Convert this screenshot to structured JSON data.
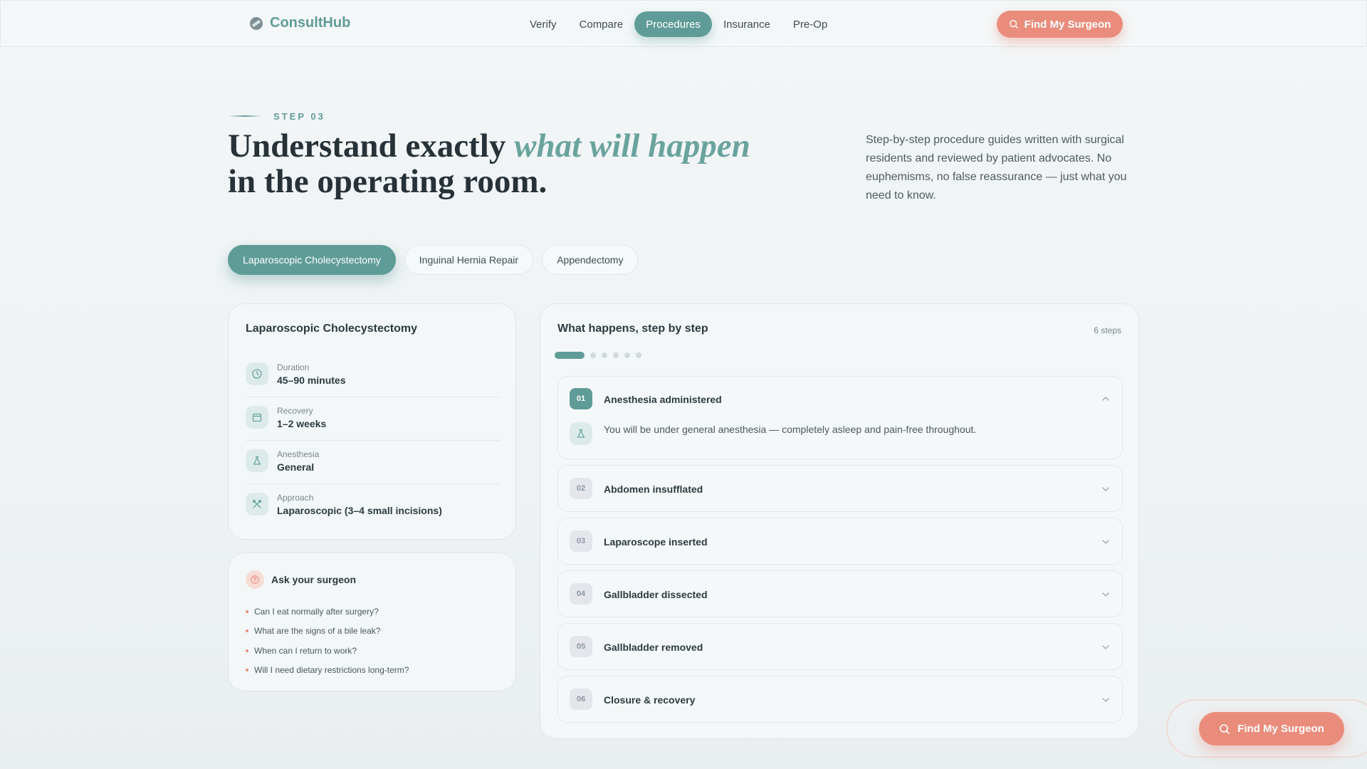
{
  "nav": {
    "brand": "ConsultHub",
    "links": [
      "Verify",
      "Compare",
      "Procedures",
      "Insurance",
      "Pre-Op"
    ],
    "active_link": "Procedures",
    "cta_label": "Find My Surgeon"
  },
  "hero": {
    "step_label": "STEP 03",
    "title_part1": "Understand exactly ",
    "title_emphasis": "what will happen",
    "title_part2": " in the operating room.",
    "description": "Step-by-step procedure guides written with surgical residents and reviewed by patient advocates. No euphemisms, no false reassurance — just what you need to know."
  },
  "tabs": [
    {
      "label": "Laparoscopic Cholecystectomy",
      "active": true
    },
    {
      "label": "Inguinal Hernia Repair",
      "active": false
    },
    {
      "label": "Appendectomy",
      "active": false
    }
  ],
  "summary": {
    "title": "Laparoscopic Cholecystectomy",
    "facts": [
      {
        "label": "Duration",
        "value": "45–90 minutes",
        "icon": "clock-icon"
      },
      {
        "label": "Recovery",
        "value": "1–2 weeks",
        "icon": "calendar-icon"
      },
      {
        "label": "Anesthesia",
        "value": "General",
        "icon": "flask-icon"
      },
      {
        "label": "Approach",
        "value": "Laparoscopic (3–4 small incisions)",
        "icon": "tools-icon"
      }
    ]
  },
  "ask": {
    "title": "Ask your surgeon",
    "questions": [
      "Can I eat normally after surgery?",
      "What are the signs of a bile leak?",
      "When can I return to work?",
      "Will I need dietary restrictions long-term?"
    ]
  },
  "steps": {
    "title": "What happens, step by step",
    "count_label": "6 steps",
    "current_step": 1,
    "items": [
      {
        "num": "01",
        "name": "Anesthesia administered",
        "expanded": true,
        "detail": "You will be under general anesthesia — completely asleep and pain-free throughout."
      },
      {
        "num": "02",
        "name": "Abdomen insufflated",
        "expanded": false
      },
      {
        "num": "03",
        "name": "Laparoscope inserted",
        "expanded": false
      },
      {
        "num": "04",
        "name": "Gallbladder dissected",
        "expanded": false
      },
      {
        "num": "05",
        "name": "Gallbladder removed",
        "expanded": false
      },
      {
        "num": "06",
        "name": "Closure & recovery",
        "expanded": false
      }
    ]
  },
  "floating_cta": {
    "label": "Find My Surgeon"
  },
  "colors": {
    "accent": "#5f9c97",
    "cta": "#ea8c7c",
    "background": "#f3f6f7"
  }
}
